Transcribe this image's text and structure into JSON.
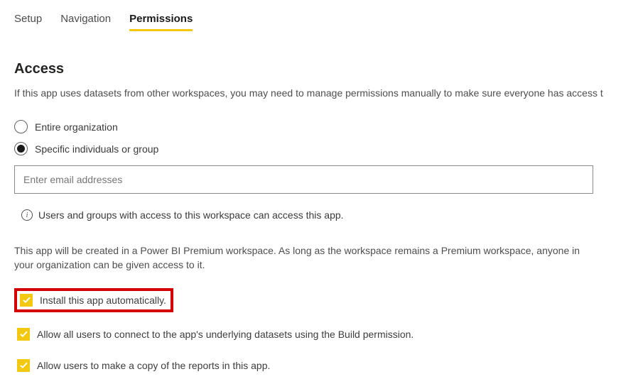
{
  "tabs": {
    "setup": "Setup",
    "navigation": "Navigation",
    "permissions": "Permissions"
  },
  "section": {
    "heading": "Access",
    "intro": "If this app uses datasets from other workspaces, you may need to manage permissions manually to make sure everyone has access t"
  },
  "radios": {
    "entire": "Entire organization",
    "specific": "Specific individuals or group"
  },
  "email": {
    "placeholder": "Enter email addresses",
    "value": ""
  },
  "info": "Users and groups with access to this workspace can access this app.",
  "premium_note": "This app will be created in a Power BI Premium workspace. As long as the workspace remains a Premium workspace, anyone in your organization can be given access to it.",
  "checkboxes": {
    "install_auto": "Install this app automatically.",
    "allow_build": "Allow all users to connect to the app's underlying datasets using the Build permission.",
    "allow_copy": "Allow users to make a copy of the reports in this app."
  },
  "colors": {
    "brand_yellow": "#f2c811",
    "highlight_red": "#d40000"
  }
}
